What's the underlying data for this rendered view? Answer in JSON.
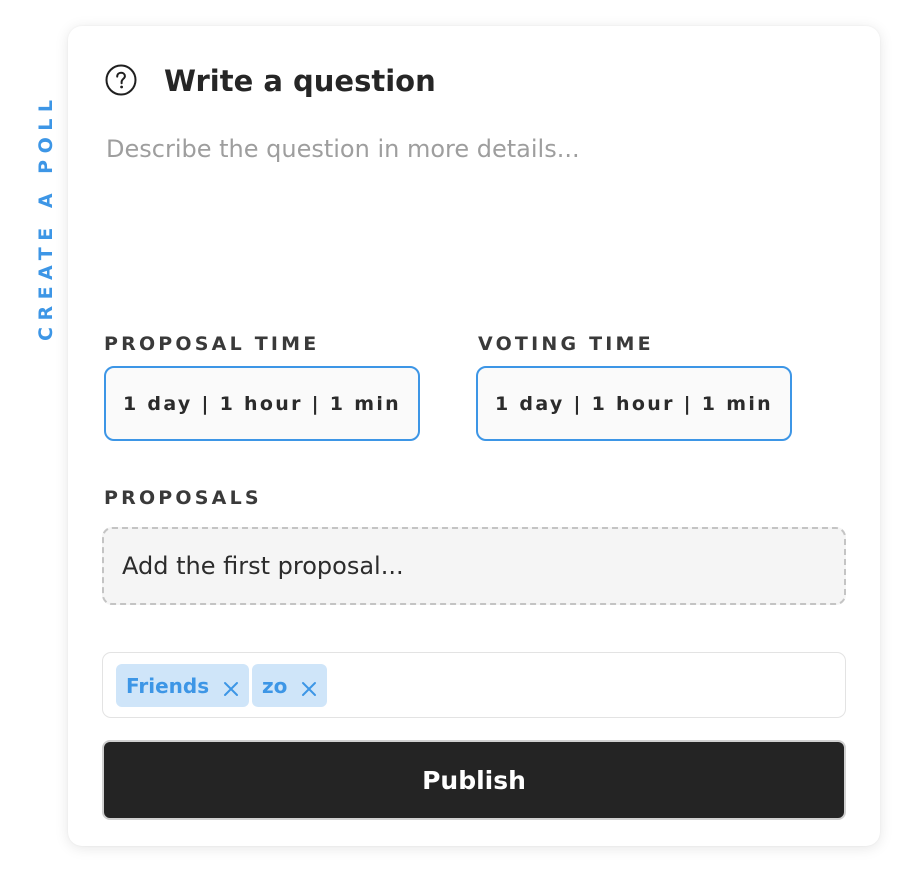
{
  "side_label": "CREATE A POLL",
  "header": {
    "icon": "question-circle-icon",
    "title": "Write a question"
  },
  "description": {
    "placeholder": "Describe the question in more details..."
  },
  "proposal_time": {
    "label": "PROPOSAL TIME",
    "value": "1 day | 1 hour | 1 min"
  },
  "voting_time": {
    "label": "VOTING TIME",
    "value": "1 day | 1 hour | 1 min"
  },
  "proposals": {
    "label": "PROPOSALS",
    "placeholder": "Add the first proposal..."
  },
  "tags": [
    {
      "label": "Friends",
      "remove_icon": "close-icon"
    },
    {
      "label": "zo",
      "remove_icon": "close-icon"
    }
  ],
  "publish_label": "Publish",
  "colors": {
    "accent": "#3d96e6",
    "tag_background": "#cfe5f9",
    "button_background": "#242424"
  }
}
